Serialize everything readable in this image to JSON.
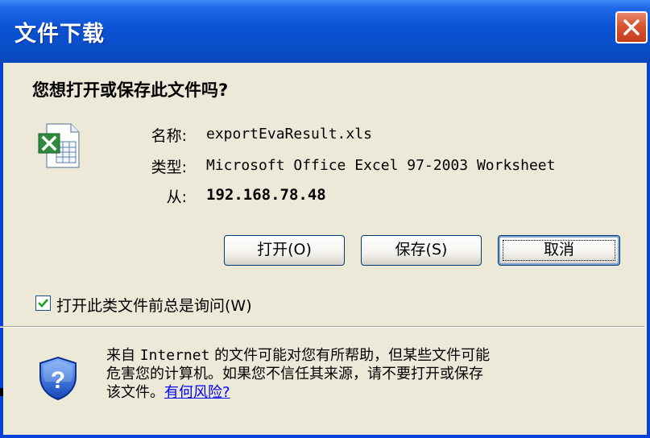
{
  "window": {
    "title": "文件下载",
    "close_icon": "close-icon"
  },
  "dialog": {
    "question": "您想打开或保存此文件吗?",
    "file_icon": "excel-file-icon",
    "name_label": "名称:",
    "name_value": "exportEvaResult.xls",
    "type_label": "类型:",
    "type_value": "Microsoft Office Excel 97-2003 Worksheet",
    "from_label": "从:",
    "from_value": "192.168.78.48"
  },
  "buttons": {
    "open": "打开(O)",
    "save": "保存(S)",
    "cancel": "取消"
  },
  "checkbox": {
    "label": "打开此类文件前总是询问(W)",
    "checked": true
  },
  "warning": {
    "icon": "shield-question-icon",
    "line1_a": "来自 ",
    "line1_internet": "Internet",
    "line1_b": " 的文件可能对您有所帮助，但某些文件可能",
    "line2": "危害您的计算机。如果您不信任其来源，请不要打开或保存",
    "line3": "该文件。",
    "link": "有何风险?"
  },
  "colors": {
    "titlebar": "#0a52d4",
    "dialog_bg": "#ece9d8",
    "link": "#0000ff"
  }
}
